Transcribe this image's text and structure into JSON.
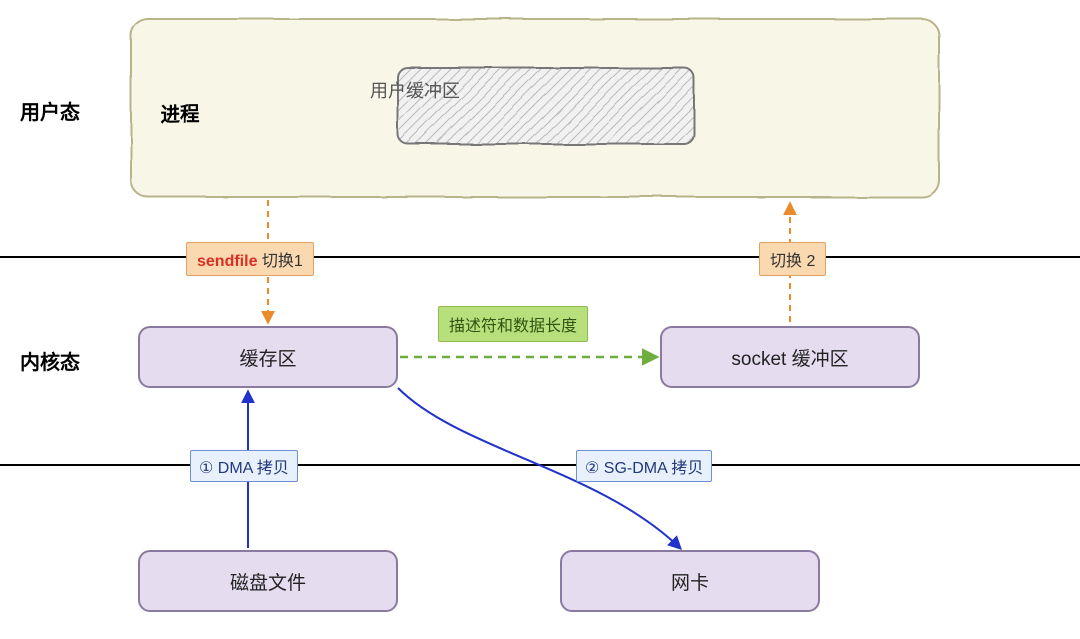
{
  "layers": {
    "user": "用户态",
    "kernel": "内核态"
  },
  "user_container": {
    "process_label": "进程",
    "user_buffer": "用户缓冲区"
  },
  "boxes": {
    "cache": "缓存区",
    "socket_buf": "socket 缓冲区",
    "disk": "磁盘文件",
    "nic": "网卡"
  },
  "tags": {
    "switch1_prefix": "sendfile",
    "switch1_suffix": " 切换1",
    "switch2": "切换 2",
    "dma": "① DMA 拷贝",
    "sgdma": "② SG-DMA 拷贝",
    "desc": "描述符和数据长度"
  },
  "colors": {
    "purple_fill": "#e5dcef",
    "purple_border": "#8a7aa0",
    "cream_fill": "#f8f6e6",
    "green_fill": "#b7df7c",
    "orange_fill": "#fad9b0",
    "blue_arrow": "#2233cc",
    "orange_arrow": "#e98b2a",
    "green_arrow": "#6fae3e"
  }
}
